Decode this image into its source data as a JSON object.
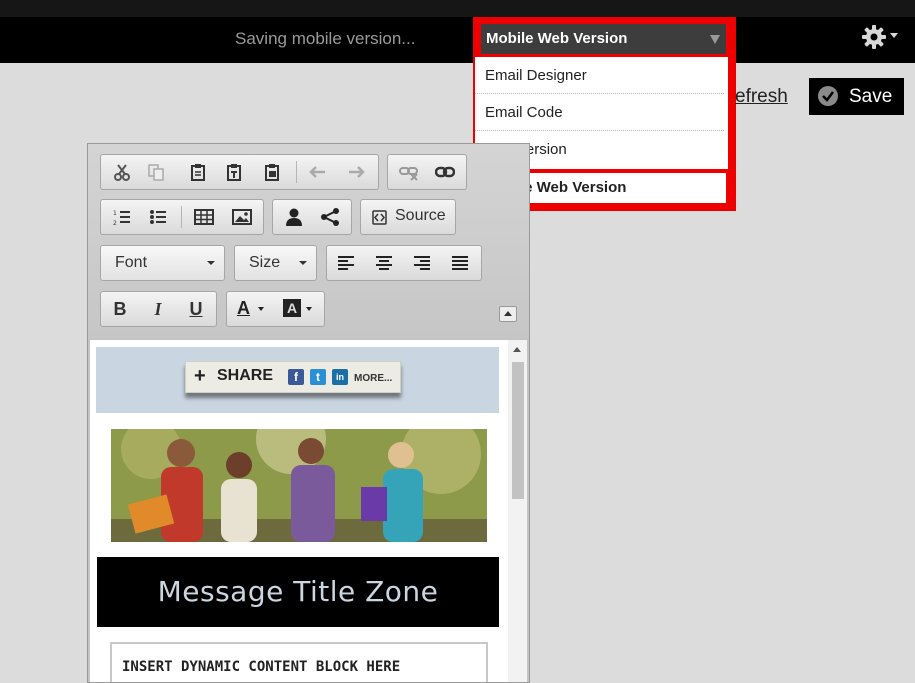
{
  "topbar": {
    "status_text": "Saving mobile version...",
    "settings_icon": "gear-icon"
  },
  "version_select": {
    "selected": "Mobile Web Version",
    "options": [
      "Email Designer",
      "Email Code",
      "Text Version",
      "Mobile Web Version"
    ]
  },
  "actions": {
    "refresh_label": "efresh",
    "save_label": "Save"
  },
  "toolbar": {
    "row1": [
      "cut-icon",
      "copy-icon",
      "paste-icon",
      "paste-text-icon",
      "paste-word-icon",
      "undo-icon",
      "redo-icon",
      "unlink-icon",
      "link-icon"
    ],
    "row2": [
      "numbered-list-icon",
      "bulleted-list-icon",
      "table-icon",
      "image-icon",
      "person-icon",
      "share-icon",
      "source-icon"
    ],
    "source_label": "Source",
    "font_label": "Font",
    "size_label": "Size",
    "bold_label": "B",
    "italic_label": "I",
    "underline_label": "U",
    "text_color_label": "A",
    "bg_color_label": "A"
  },
  "content": {
    "share_label": "SHARE",
    "share_more": "MORE...",
    "social_icons": [
      {
        "name": "facebook-icon",
        "glyph": "f",
        "color": "#3b5998"
      },
      {
        "name": "twitter-icon",
        "glyph": "t",
        "color": "#2b8fd6"
      },
      {
        "name": "linkedin-icon",
        "glyph": "in",
        "color": "#1a6fa6"
      }
    ],
    "title_zone": "Message Title Zone",
    "dynamic_block_text": "INSERT DYNAMIC CONTENT BLOCK HERE"
  },
  "colors": {
    "highlight": "#ee0000",
    "topbar_bg": "#000000",
    "page_bg": "#dcdcdc"
  }
}
